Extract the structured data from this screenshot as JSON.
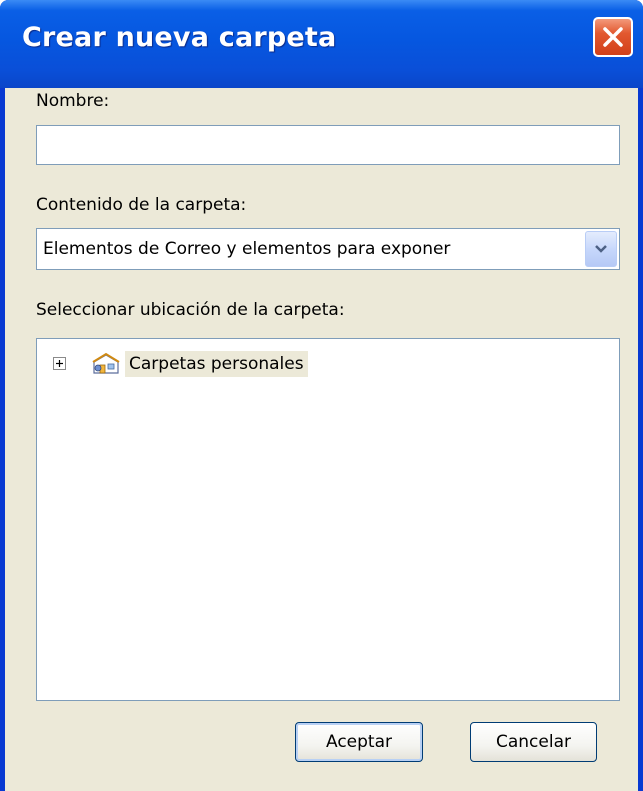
{
  "window": {
    "title": "Crear nueva carpeta",
    "close_icon": "close-icon"
  },
  "form": {
    "name_label": "Nombre:",
    "name_value": "",
    "content_label": "Contenido de la carpeta:",
    "content_value": "Elementos de Correo y elementos para exponer",
    "location_label": "Seleccionar ubicación de la carpeta:"
  },
  "tree": {
    "items": [
      {
        "label": "Carpetas personales",
        "icon": "personal-folders-icon",
        "expanded": false,
        "selected": true
      }
    ]
  },
  "buttons": {
    "ok_label": "Aceptar",
    "cancel_label": "Cancelar"
  },
  "colors": {
    "title_bar": "#0657e0",
    "dialog_background": "#ece9d8",
    "close_button": "#e2582f",
    "field_border": "#7f9db9"
  }
}
